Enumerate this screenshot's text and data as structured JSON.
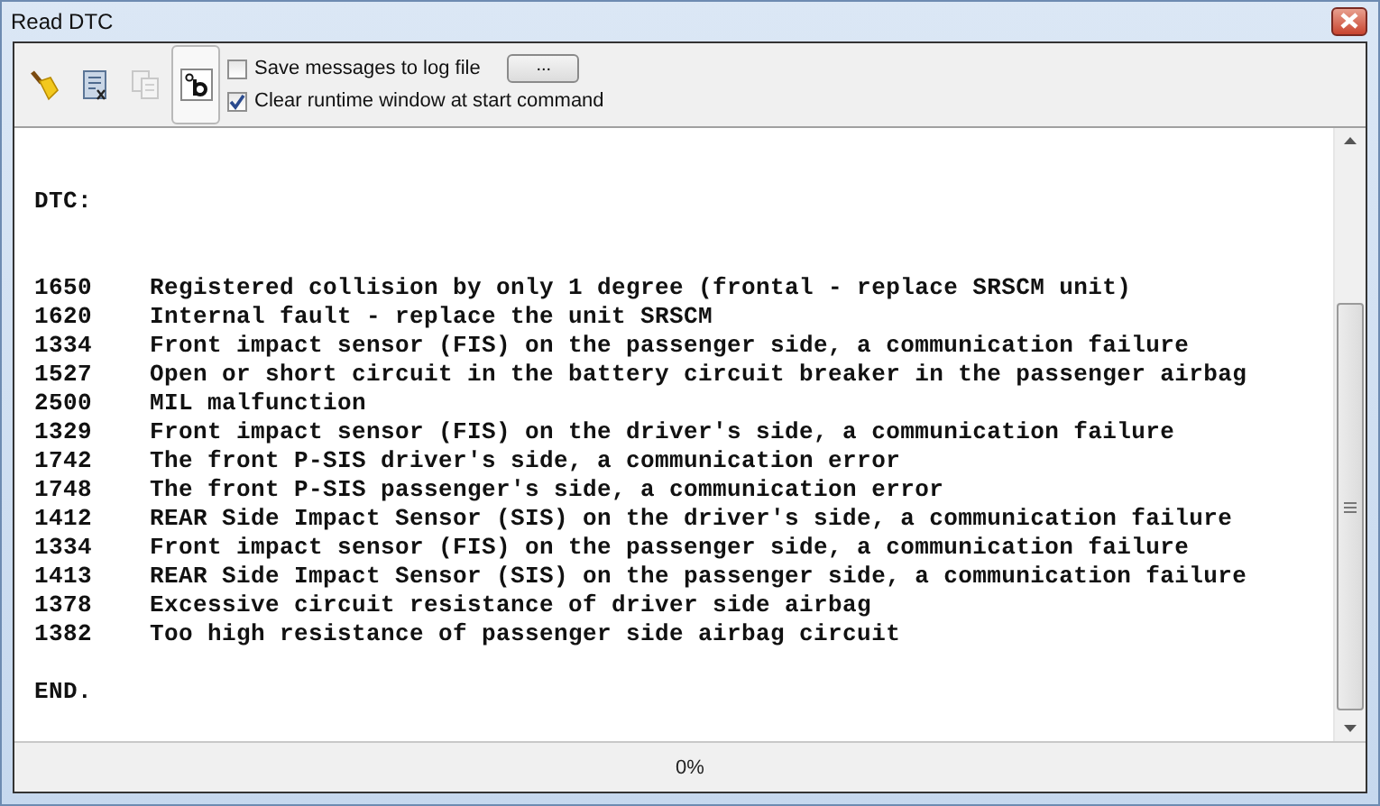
{
  "window": {
    "title": "Read DTC"
  },
  "toolbar": {
    "buttons": [
      {
        "kind": "broom",
        "selected": false,
        "disabled": false
      },
      {
        "kind": "clear-doc",
        "selected": false,
        "disabled": false
      },
      {
        "kind": "copy",
        "selected": false,
        "disabled": true
      },
      {
        "kind": "font",
        "selected": true,
        "disabled": false
      }
    ],
    "options": [
      {
        "label": "Save messages to log file",
        "checked": false
      },
      {
        "label": "Clear runtime window at start command",
        "checked": true
      }
    ],
    "browse_button": "..."
  },
  "output": {
    "header": "DTC:",
    "entries": [
      {
        "code": "1650",
        "description": "Registered collision by only 1 degree (frontal - replace SRSCM unit)"
      },
      {
        "code": "1620",
        "description": "Internal fault - replace the unit SRSCM"
      },
      {
        "code": "1334",
        "description": "Front impact sensor (FIS) on the passenger side, a communication failure"
      },
      {
        "code": "1527",
        "description": "Open or short circuit in the battery circuit breaker in the passenger airbag"
      },
      {
        "code": "2500",
        "description": "MIL malfunction"
      },
      {
        "code": "1329",
        "description": "Front impact sensor (FIS) on the driver's side, a communication failure"
      },
      {
        "code": "1742",
        "description": "The front P-SIS driver's side, a communication error"
      },
      {
        "code": "1748",
        "description": "The front P-SIS passenger's side, a communication error"
      },
      {
        "code": "1412",
        "description": "REAR Side Impact Sensor (SIS) on the driver's side, a communication failure"
      },
      {
        "code": "1334",
        "description": "Front impact sensor (FIS) on the passenger side, a communication failure"
      },
      {
        "code": "1413",
        "description": "REAR Side Impact Sensor (SIS) on the passenger side, a communication failure"
      },
      {
        "code": "1378",
        "description": "Excessive circuit resistance of driver side airbag"
      },
      {
        "code": "1382",
        "description": "Too high resistance of passenger side airbag circuit"
      }
    ],
    "footer": "END."
  },
  "status_bar": {
    "progress": "0%"
  }
}
